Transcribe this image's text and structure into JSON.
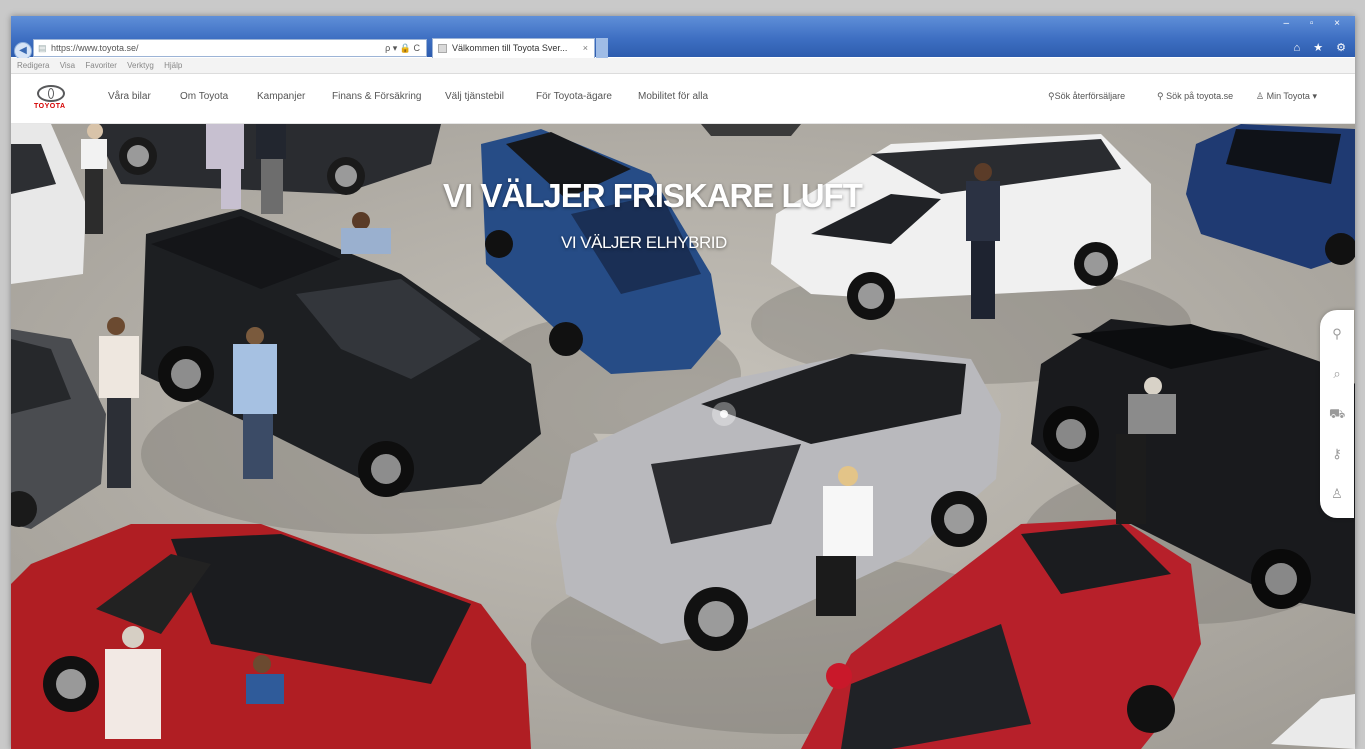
{
  "browser": {
    "address_url": "https://www.toyota.se/",
    "address_tools": "ρ ▾ 🔒 C",
    "tab_title": "Välkommen till Toyota Sver...",
    "tab_close": "×",
    "window_controls": "– ▫ ×",
    "right_icons": "⌂ ★ ⚙",
    "menu": [
      "Redigera",
      "Visa",
      "Favoriter",
      "Verktyg",
      "Hjälp"
    ]
  },
  "site": {
    "logo_text": "TOYOTA",
    "nav": [
      "Våra bilar",
      "Om Toyota",
      "Kampanjer",
      "Finans & Försäkring",
      "Välj tjänstebil",
      "För Toyota-ägare",
      "Mobilitet för alla"
    ],
    "utility": {
      "dealer": "Sök återförsäljare",
      "search": "Sök på toyota.se",
      "account": "Min Toyota"
    }
  },
  "hero": {
    "title": "VI VÄLJER FRISKARE LUFT",
    "subtitle": "VI VÄLJER ELHYBRID"
  },
  "dock": {
    "icons": [
      "map-pin-icon",
      "search-icon",
      "car-icon",
      "key-icon",
      "user-icon"
    ]
  }
}
